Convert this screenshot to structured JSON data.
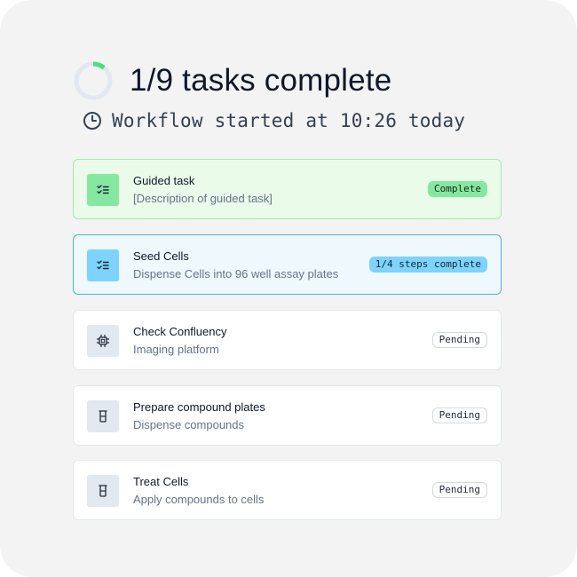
{
  "header": {
    "title": "1/9 tasks complete",
    "progress_fraction": 0.111,
    "subtitle": "Workflow started at 10:26 today"
  },
  "colors": {
    "complete": "#86e8a0",
    "active": "#7dd3fc",
    "pending": "#e2e8f0"
  },
  "tasks": [
    {
      "title": "Guided task",
      "description": "[Description of guided task]",
      "status": "Complete",
      "icon": "checklist-icon"
    },
    {
      "title": "Seed Cells",
      "description": "Dispense Cells into 96 well assay plates",
      "status": "1/4 steps complete",
      "icon": "checklist-icon"
    },
    {
      "title": "Check Confluency",
      "description": "Imaging platform",
      "status": "Pending",
      "icon": "chip-icon"
    },
    {
      "title": "Prepare compound plates",
      "description": "Dispense compounds",
      "status": "Pending",
      "icon": "beaker-icon"
    },
    {
      "title": "Treat Cells",
      "description": "Apply compounds to cells",
      "status": "Pending",
      "icon": "beaker-icon"
    }
  ]
}
